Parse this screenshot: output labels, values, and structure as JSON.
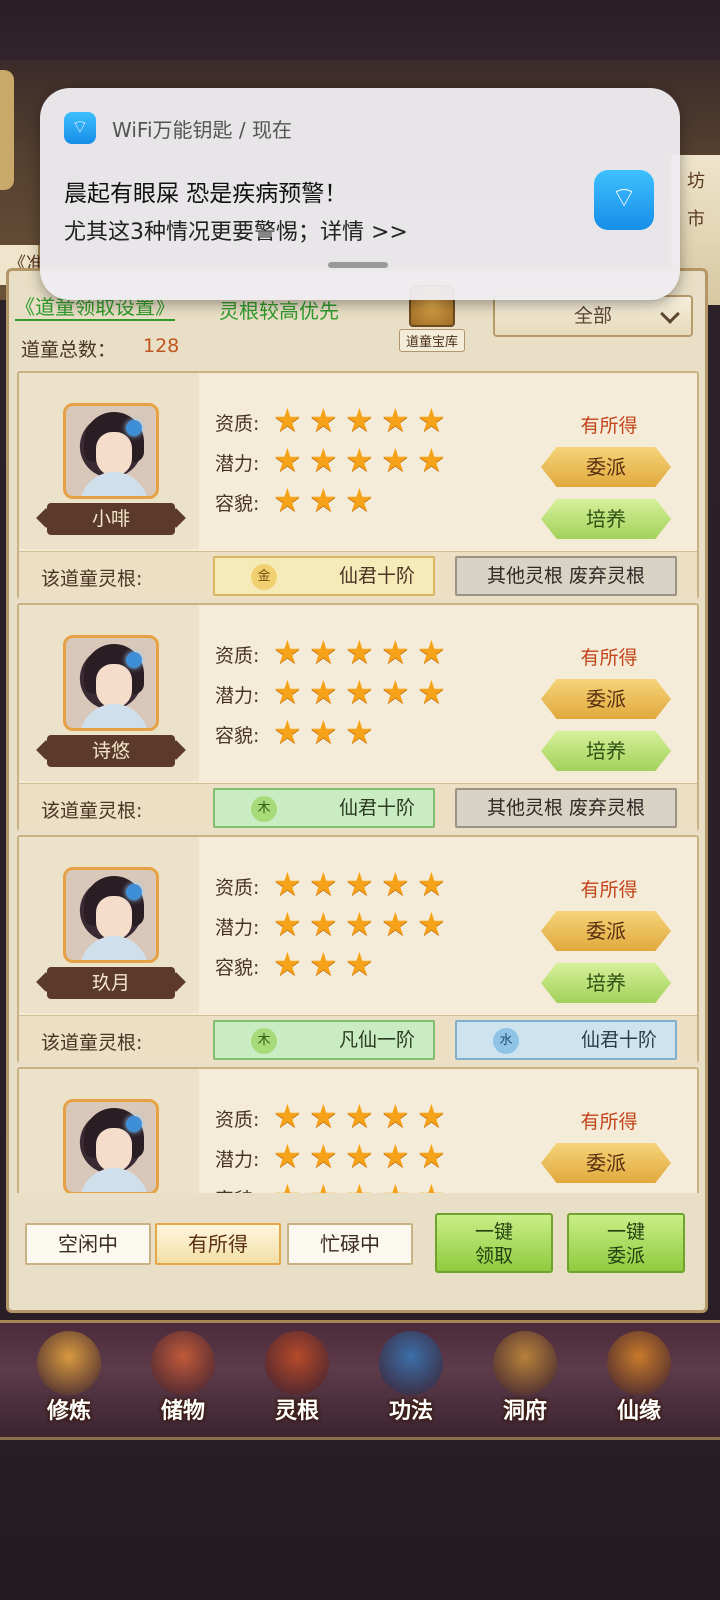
{
  "notification": {
    "app_name": "WiFi万能钥匙 / 现在",
    "title": "晨起有眼屎 恐是疾病预警！",
    "body": "尤其这3种情况更要警惕；详情 >>"
  },
  "frame": {
    "right_labels": [
      "坊",
      "市"
    ],
    "left_tab": "《准"
  },
  "header": {
    "setting_link": "《道童领取设置》",
    "priority_link": "灵根较高优先",
    "treasury_label": "道童宝库",
    "filter_value": "全部",
    "total_label": "道童总数：",
    "total_value": "128"
  },
  "labels": {
    "aptitude": "资质:",
    "potential": "潜力:",
    "appearance": "容貌:",
    "root_label": "该道童灵根:",
    "assign": "委派",
    "train": "培养"
  },
  "cards": [
    {
      "name": "小啡",
      "status": "有所得",
      "aptitude": 5,
      "potential": 5,
      "appearance": 3,
      "root1": {
        "element": "金",
        "text": "仙君十阶",
        "color": "gold"
      },
      "root2": {
        "text": "其他灵根 废弃灵根",
        "type": "other"
      }
    },
    {
      "name": "诗悠",
      "status": "有所得",
      "aptitude": 5,
      "potential": 5,
      "appearance": 3,
      "root1": {
        "element": "木",
        "text": "仙君十阶",
        "color": "wood"
      },
      "root2": {
        "text": "其他灵根 废弃灵根",
        "type": "other"
      }
    },
    {
      "name": "玖月",
      "status": "有所得",
      "aptitude": 5,
      "potential": 5,
      "appearance": 3,
      "root1": {
        "element": "木",
        "text": "凡仙一阶",
        "color": "wood"
      },
      "root2": {
        "element": "水",
        "text": "仙君十阶",
        "type": "water"
      }
    },
    {
      "name": "",
      "status": "有所得",
      "aptitude": 5,
      "potential": 5,
      "appearance": 5
    }
  ],
  "tabs": [
    "空闲中",
    "有所得",
    "忙碌中"
  ],
  "active_tab": "有所得",
  "actions": {
    "collect_all": "一键\n领取",
    "assign_all": "一键\n委派"
  },
  "nav": [
    {
      "label": "修炼",
      "icon": "cultivation-icon",
      "color": "#d89a3e"
    },
    {
      "label": "储物",
      "icon": "storage-bag-icon",
      "color": "#c05a3a"
    },
    {
      "label": "灵根",
      "icon": "spirit-root-icon",
      "color": "#b54a2a"
    },
    {
      "label": "功法",
      "icon": "technique-book-icon",
      "color": "#3c6fa8"
    },
    {
      "label": "洞府",
      "icon": "cave-house-icon",
      "color": "#b8823a"
    },
    {
      "label": "仙缘",
      "icon": "immortal-fate-icon",
      "color": "#c87a2a"
    }
  ]
}
